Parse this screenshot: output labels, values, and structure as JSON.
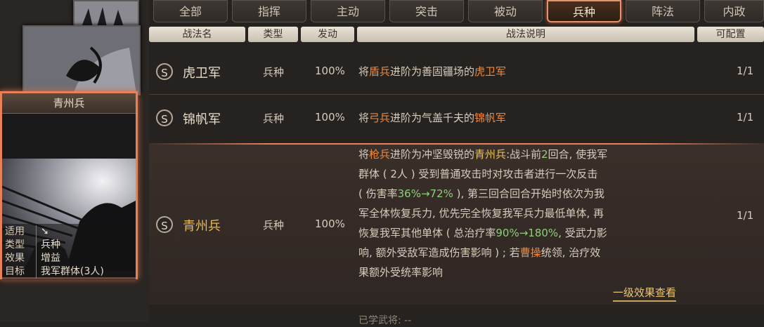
{
  "tabs": [
    "全部",
    "指挥",
    "主动",
    "突击",
    "被动",
    "兵种",
    "阵法",
    "内政"
  ],
  "active_tab": 5,
  "columns": [
    "战法名",
    "类型",
    "发动",
    "战法说明",
    "可配置"
  ],
  "card": {
    "title": "青州兵",
    "info": [
      {
        "key": "适用",
        "val": ""
      },
      {
        "key": "类型",
        "val": "兵种"
      },
      {
        "key": "效果",
        "val": "增益"
      },
      {
        "key": "目标",
        "val": "我军群体(3人)"
      }
    ]
  },
  "skills": [
    {
      "badge": "S",
      "name": "虎卫军",
      "type": "兵种",
      "rate": "100%",
      "count": "1/1",
      "desc": [
        {
          "t": "将"
        },
        {
          "t": "盾兵",
          "c": "orange"
        },
        {
          "t": "进阶为善固疆场的"
        },
        {
          "t": "虎卫军",
          "c": "orange"
        }
      ]
    },
    {
      "badge": "S",
      "name": "锦帆军",
      "type": "兵种",
      "rate": "100%",
      "count": "1/1",
      "desc": [
        {
          "t": "将"
        },
        {
          "t": "弓兵",
          "c": "orange"
        },
        {
          "t": "进阶为气盖千夫的"
        },
        {
          "t": "锦帆军",
          "c": "orange"
        }
      ]
    },
    {
      "badge": "S",
      "name": "青州兵",
      "type": "兵种",
      "rate": "100%",
      "count": "1/1",
      "desc_lines": [
        [
          {
            "t": "将"
          },
          {
            "t": "枪兵",
            "c": "orange"
          },
          {
            "t": "进阶为冲坚毁锐的"
          },
          {
            "t": "青州兵",
            "c": "gold"
          },
          {
            "t": ":战斗前"
          },
          {
            "t": "2",
            "c": "green"
          },
          {
            "t": "回合, 使我军"
          }
        ],
        [
          {
            "t": "群体 ( 2人 ) 受到普通攻击时对攻击者进行一次反击"
          }
        ],
        [
          {
            "t": "( 伤害率"
          },
          {
            "t": "36%→72%",
            "c": "green"
          },
          {
            "t": " ), 第三回合回合开始时依次为我"
          }
        ],
        [
          {
            "t": "军全体恢复兵力, 优先完全恢复我军兵力最低单体, 再"
          }
        ],
        [
          {
            "t": "恢复我军其他单体 ( 总治疗率"
          },
          {
            "t": "90%→180%",
            "c": "green"
          },
          {
            "t": ", 受武力影"
          }
        ],
        [
          {
            "t": "响, 额外受敌军造成伤害影响 ) ; 若"
          },
          {
            "t": "曹操",
            "c": "orange"
          },
          {
            "t": "统领, 治疗效"
          }
        ],
        [
          {
            "t": "果额外受统率影响"
          }
        ]
      ],
      "more_link": "一级效果查看",
      "learned": "已学武将: --"
    }
  ],
  "colors": {
    "accent": "#e8815a",
    "orange": "#f08a3c",
    "gold": "#e9c15b",
    "green": "#8fce7c"
  },
  "icons": {
    "badge": "s-badge-icon",
    "card_use": "cavalry-icon"
  }
}
